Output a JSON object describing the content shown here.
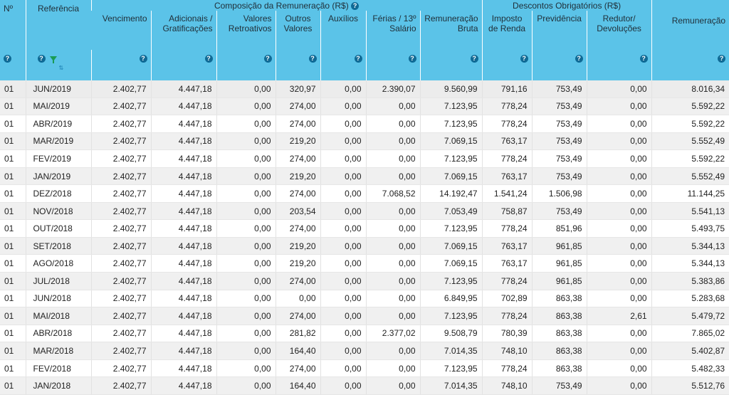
{
  "headers": {
    "num": "Nº",
    "ref": "Referência",
    "group_comp": "Composição da Remuneração (R$)",
    "group_desc": "Descontos Obrigatórios (R$)",
    "vencimento": "Vencimento",
    "adicionais": "Adicionais / Gratificações",
    "retroativos": "Valores Retroativos",
    "outros": "Outros Valores",
    "auxilios": "Auxílios",
    "ferias": "Férias / 13º Salário",
    "bruta": "Remuneração Bruta",
    "imposto": "Imposto de Renda",
    "previdencia": "Previdência",
    "redutor": "Redutor/ Devoluções",
    "liquida": "Remuneração"
  },
  "icons": {
    "help": "?",
    "filter_color": "#1a9b54",
    "sort_glyph": "⇅"
  },
  "rows": [
    {
      "n": "01",
      "ref": "JUN/2019",
      "venc": "2.402,77",
      "adic": "4.447,18",
      "retro": "0,00",
      "outros": "320,97",
      "aux": "0,00",
      "ferias": "2.390,07",
      "bruta": "9.560,99",
      "ir": "791,16",
      "prev": "753,49",
      "red": "0,00",
      "liq": "8.016,34"
    },
    {
      "n": "01",
      "ref": "MAI/2019",
      "venc": "2.402,77",
      "adic": "4.447,18",
      "retro": "0,00",
      "outros": "274,00",
      "aux": "0,00",
      "ferias": "0,00",
      "bruta": "7.123,95",
      "ir": "778,24",
      "prev": "753,49",
      "red": "0,00",
      "liq": "5.592,22"
    },
    {
      "n": "01",
      "ref": "ABR/2019",
      "venc": "2.402,77",
      "adic": "4.447,18",
      "retro": "0,00",
      "outros": "274,00",
      "aux": "0,00",
      "ferias": "0,00",
      "bruta": "7.123,95",
      "ir": "778,24",
      "prev": "753,49",
      "red": "0,00",
      "liq": "5.592,22"
    },
    {
      "n": "01",
      "ref": "MAR/2019",
      "venc": "2.402,77",
      "adic": "4.447,18",
      "retro": "0,00",
      "outros": "219,20",
      "aux": "0,00",
      "ferias": "0,00",
      "bruta": "7.069,15",
      "ir": "763,17",
      "prev": "753,49",
      "red": "0,00",
      "liq": "5.552,49"
    },
    {
      "n": "01",
      "ref": "FEV/2019",
      "venc": "2.402,77",
      "adic": "4.447,18",
      "retro": "0,00",
      "outros": "274,00",
      "aux": "0,00",
      "ferias": "0,00",
      "bruta": "7.123,95",
      "ir": "778,24",
      "prev": "753,49",
      "red": "0,00",
      "liq": "5.592,22"
    },
    {
      "n": "01",
      "ref": "JAN/2019",
      "venc": "2.402,77",
      "adic": "4.447,18",
      "retro": "0,00",
      "outros": "219,20",
      "aux": "0,00",
      "ferias": "0,00",
      "bruta": "7.069,15",
      "ir": "763,17",
      "prev": "753,49",
      "red": "0,00",
      "liq": "5.552,49"
    },
    {
      "n": "01",
      "ref": "DEZ/2018",
      "venc": "2.402,77",
      "adic": "4.447,18",
      "retro": "0,00",
      "outros": "274,00",
      "aux": "0,00",
      "ferias": "7.068,52",
      "bruta": "14.192,47",
      "ir": "1.541,24",
      "prev": "1.506,98",
      "red": "0,00",
      "liq": "11.144,25"
    },
    {
      "n": "01",
      "ref": "NOV/2018",
      "venc": "2.402,77",
      "adic": "4.447,18",
      "retro": "0,00",
      "outros": "203,54",
      "aux": "0,00",
      "ferias": "0,00",
      "bruta": "7.053,49",
      "ir": "758,87",
      "prev": "753,49",
      "red": "0,00",
      "liq": "5.541,13"
    },
    {
      "n": "01",
      "ref": "OUT/2018",
      "venc": "2.402,77",
      "adic": "4.447,18",
      "retro": "0,00",
      "outros": "274,00",
      "aux": "0,00",
      "ferias": "0,00",
      "bruta": "7.123,95",
      "ir": "778,24",
      "prev": "851,96",
      "red": "0,00",
      "liq": "5.493,75"
    },
    {
      "n": "01",
      "ref": "SET/2018",
      "venc": "2.402,77",
      "adic": "4.447,18",
      "retro": "0,00",
      "outros": "219,20",
      "aux": "0,00",
      "ferias": "0,00",
      "bruta": "7.069,15",
      "ir": "763,17",
      "prev": "961,85",
      "red": "0,00",
      "liq": "5.344,13"
    },
    {
      "n": "01",
      "ref": "AGO/2018",
      "venc": "2.402,77",
      "adic": "4.447,18",
      "retro": "0,00",
      "outros": "219,20",
      "aux": "0,00",
      "ferias": "0,00",
      "bruta": "7.069,15",
      "ir": "763,17",
      "prev": "961,85",
      "red": "0,00",
      "liq": "5.344,13"
    },
    {
      "n": "01",
      "ref": "JUL/2018",
      "venc": "2.402,77",
      "adic": "4.447,18",
      "retro": "0,00",
      "outros": "274,00",
      "aux": "0,00",
      "ferias": "0,00",
      "bruta": "7.123,95",
      "ir": "778,24",
      "prev": "961,85",
      "red": "0,00",
      "liq": "5.383,86"
    },
    {
      "n": "01",
      "ref": "JUN/2018",
      "venc": "2.402,77",
      "adic": "4.447,18",
      "retro": "0,00",
      "outros": "0,00",
      "aux": "0,00",
      "ferias": "0,00",
      "bruta": "6.849,95",
      "ir": "702,89",
      "prev": "863,38",
      "red": "0,00",
      "liq": "5.283,68"
    },
    {
      "n": "01",
      "ref": "MAI/2018",
      "venc": "2.402,77",
      "adic": "4.447,18",
      "retro": "0,00",
      "outros": "274,00",
      "aux": "0,00",
      "ferias": "0,00",
      "bruta": "7.123,95",
      "ir": "778,24",
      "prev": "863,38",
      "red": "2,61",
      "liq": "5.479,72"
    },
    {
      "n": "01",
      "ref": "ABR/2018",
      "venc": "2.402,77",
      "adic": "4.447,18",
      "retro": "0,00",
      "outros": "281,82",
      "aux": "0,00",
      "ferias": "2.377,02",
      "bruta": "9.508,79",
      "ir": "780,39",
      "prev": "863,38",
      "red": "0,00",
      "liq": "7.865,02"
    },
    {
      "n": "01",
      "ref": "MAR/2018",
      "venc": "2.402,77",
      "adic": "4.447,18",
      "retro": "0,00",
      "outros": "164,40",
      "aux": "0,00",
      "ferias": "0,00",
      "bruta": "7.014,35",
      "ir": "748,10",
      "prev": "863,38",
      "red": "0,00",
      "liq": "5.402,87"
    },
    {
      "n": "01",
      "ref": "FEV/2018",
      "venc": "2.402,77",
      "adic": "4.447,18",
      "retro": "0,00",
      "outros": "274,00",
      "aux": "0,00",
      "ferias": "0,00",
      "bruta": "7.123,95",
      "ir": "778,24",
      "prev": "863,38",
      "red": "0,00",
      "liq": "5.482,33"
    },
    {
      "n": "01",
      "ref": "JAN/2018",
      "venc": "2.402,77",
      "adic": "4.447,18",
      "retro": "0,00",
      "outros": "164,40",
      "aux": "0,00",
      "ferias": "0,00",
      "bruta": "7.014,35",
      "ir": "748,10",
      "prev": "753,49",
      "red": "0,00",
      "liq": "5.512,76"
    }
  ]
}
